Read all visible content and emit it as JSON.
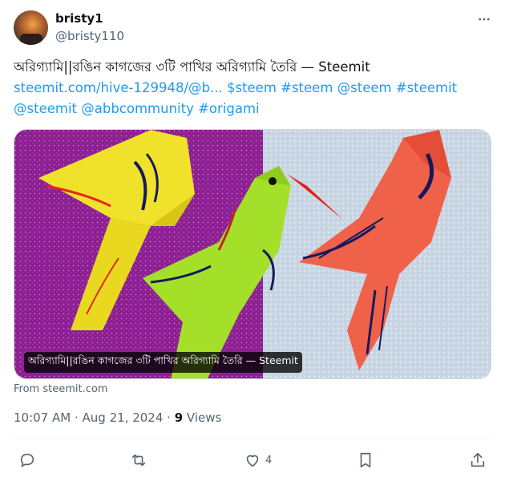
{
  "user": {
    "display_name": "bristy1",
    "handle": "@bristy110"
  },
  "post": {
    "text_line1": "অরিগ্যামি||রঙিন কাগজের ৩টি পাখির অরিগ্যামি তৈরি — Steemit",
    "text_line2": "steemit.com/hive-129948/@b... $steem #steem @steem #steemit",
    "text_line3": "@steemit @abbcommunity #origami",
    "media_caption": "অরিগ্যামি||রঙিন কাগজের ৩টি পাখির অরিগ্যামি তৈরি — Steemit",
    "from_label": "From steemit.com"
  },
  "meta": {
    "time": "10:07 AM",
    "sep1": " · ",
    "date": "Aug 21, 2024",
    "sep2": " · ",
    "views_count": "9",
    "views_label": " Views"
  },
  "actions": {
    "likes_count": "4"
  },
  "colors": {
    "link": "#1d9bf0",
    "secondary_text": "#536471",
    "primary_text": "#0f1419"
  },
  "icons": [
    "more-icon",
    "reply-icon",
    "repost-icon",
    "like-icon",
    "bookmark-icon",
    "share-icon"
  ]
}
